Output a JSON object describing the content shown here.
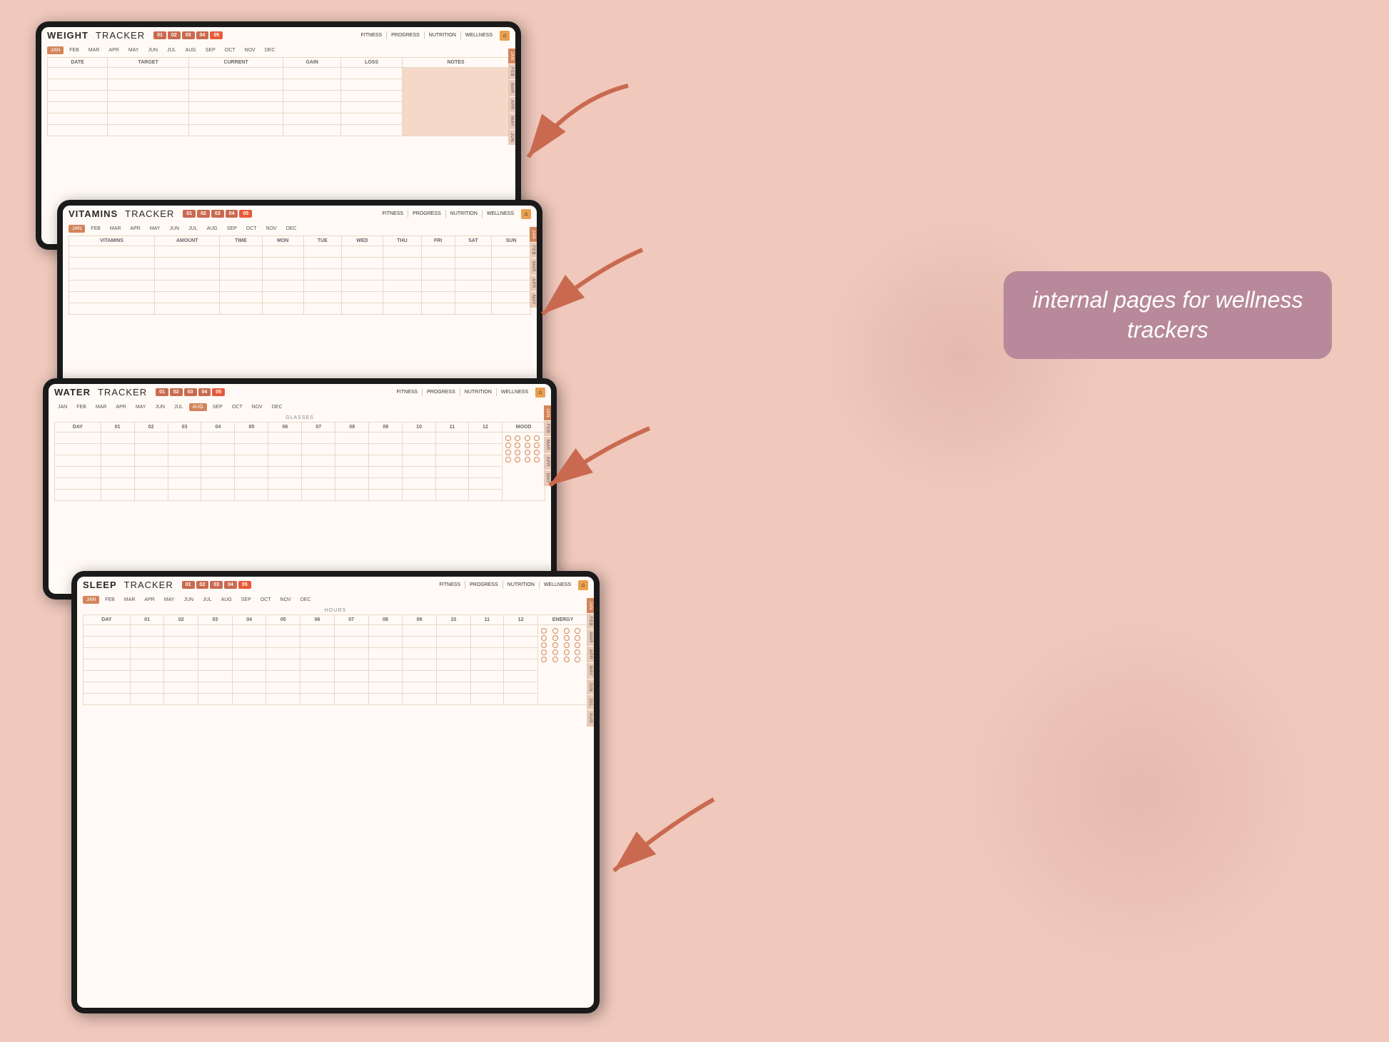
{
  "background": {
    "color": "#f0c8bc"
  },
  "text_bubble": {
    "text": "internal pages for wellness trackers",
    "bg_color": "#b8899a"
  },
  "tablets": [
    {
      "id": "weight",
      "title": "WEIGHT",
      "title_second": "TRACKER",
      "nav_tabs": [
        "01",
        "02",
        "03",
        "04",
        "05"
      ],
      "nav_links": [
        "FITNESS",
        "PROGRESS",
        "NUTRITION",
        "WELLNESS"
      ],
      "months": [
        "JAN",
        "FEB",
        "MAR",
        "APR",
        "MAY",
        "JUN",
        "JUL",
        "AUG",
        "SEP",
        "OCT",
        "NOV",
        "DEC"
      ],
      "active_month": "JAN",
      "side_tabs": [
        "JAN",
        "FEB",
        "MAR",
        "APR",
        "MAY",
        "JUN"
      ],
      "columns": [
        "DATE",
        "TARGET",
        "CURRENT",
        "GAIN",
        "LOSS",
        "NOTES"
      ],
      "rows": 6,
      "has_notes_box": true
    },
    {
      "id": "vitamins",
      "title": "VITAMINS",
      "title_second": "TRACKER",
      "nav_tabs": [
        "01",
        "02",
        "03",
        "04",
        "05"
      ],
      "nav_links": [
        "FITNESS",
        "PROGRESS",
        "NUTRITION",
        "WELLNESS"
      ],
      "months": [
        "JAN",
        "FEB",
        "MAR",
        "APR",
        "MAY",
        "JUN",
        "JUL",
        "AUG",
        "SEP",
        "OCT",
        "NOV",
        "DEC"
      ],
      "active_month": "JAN",
      "side_tabs": [
        "JAN",
        "FEB",
        "MAR",
        "APR",
        "MAY"
      ],
      "columns": [
        "VITAMINS",
        "AMOUNT",
        "TIME",
        "MON",
        "TUE",
        "WED",
        "THU",
        "FRI",
        "SAT",
        "SUN"
      ],
      "rows": 6
    },
    {
      "id": "water",
      "title": "WATER",
      "title_second": "TRACKER",
      "nav_tabs": [
        "01",
        "02",
        "03",
        "04",
        "05"
      ],
      "nav_links": [
        "FITNESS",
        "PROGRESS",
        "NUTRITION",
        "WELLNESS"
      ],
      "months": [
        "JAN",
        "FEB",
        "MAR",
        "APR",
        "MAY",
        "JUN",
        "JUL",
        "AUG",
        "SEP",
        "OCT",
        "NOV",
        "DEC"
      ],
      "active_month": "AUG",
      "side_tabs": [
        "JAN",
        "FEB",
        "MAR",
        "APR",
        "MAY"
      ],
      "section_label": "GLASSES",
      "day_columns": [
        "DAY",
        "01",
        "02",
        "03",
        "04",
        "05",
        "06",
        "07",
        "08",
        "09",
        "10",
        "11",
        "12",
        "MOOD"
      ],
      "rows": 6,
      "has_circles": true
    },
    {
      "id": "sleep",
      "title": "SLEEP",
      "title_second": "TRACKER",
      "nav_tabs": [
        "01",
        "02",
        "03",
        "04",
        "05"
      ],
      "nav_links": [
        "FITNESS",
        "PROGRESS",
        "NUTRITION",
        "WELLNESS"
      ],
      "months": [
        "JAN",
        "FEB",
        "MAR",
        "APR",
        "MAY",
        "JUN",
        "JUL",
        "AUG",
        "SEP",
        "OCT",
        "NOV",
        "DEC"
      ],
      "active_month": "JAN",
      "side_tabs": [
        "JAN",
        "FEB",
        "MAR",
        "APR",
        "MAY",
        "JUN",
        "JUL",
        "AUG"
      ],
      "section_label": "HOURS",
      "day_columns": [
        "DAY",
        "01",
        "02",
        "03",
        "04",
        "05",
        "06",
        "07",
        "08",
        "09",
        "10",
        "11",
        "12",
        "ENERGY"
      ],
      "rows": 7,
      "has_circles": true
    }
  ],
  "arrows": [
    {
      "id": "arrow1",
      "label": "→"
    },
    {
      "id": "arrow2",
      "label": "→"
    },
    {
      "id": "arrow3",
      "label": "→"
    },
    {
      "id": "arrow4",
      "label": "→"
    }
  ]
}
